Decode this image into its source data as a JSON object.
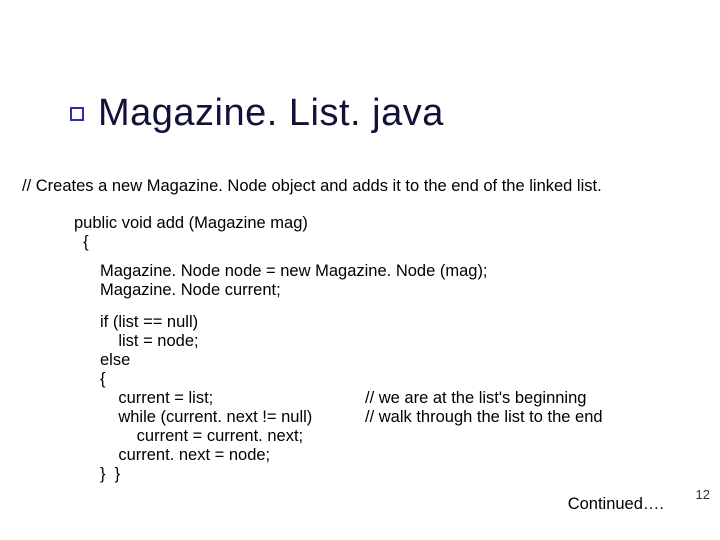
{
  "title": "Magazine. List. java",
  "comment": "//  Creates a new Magazine. Node object and adds it to the end of the linked list.",
  "method_sig": "public void add (Magazine mag)\n  {",
  "decl": "Magazine. Node node = new Magazine. Node (mag);\nMagazine. Node current;",
  "ifblock": "if (list == null)\n    list = node;\nelse\n{\n    current = list;\n    while (current. next != null)\n        current = current. next;\n    current. next = node;\n}  }",
  "else_comments": "// we are at the list's beginning\n// walk through the list to the end",
  "continued": "Continued…. ",
  "slide_number": "12"
}
